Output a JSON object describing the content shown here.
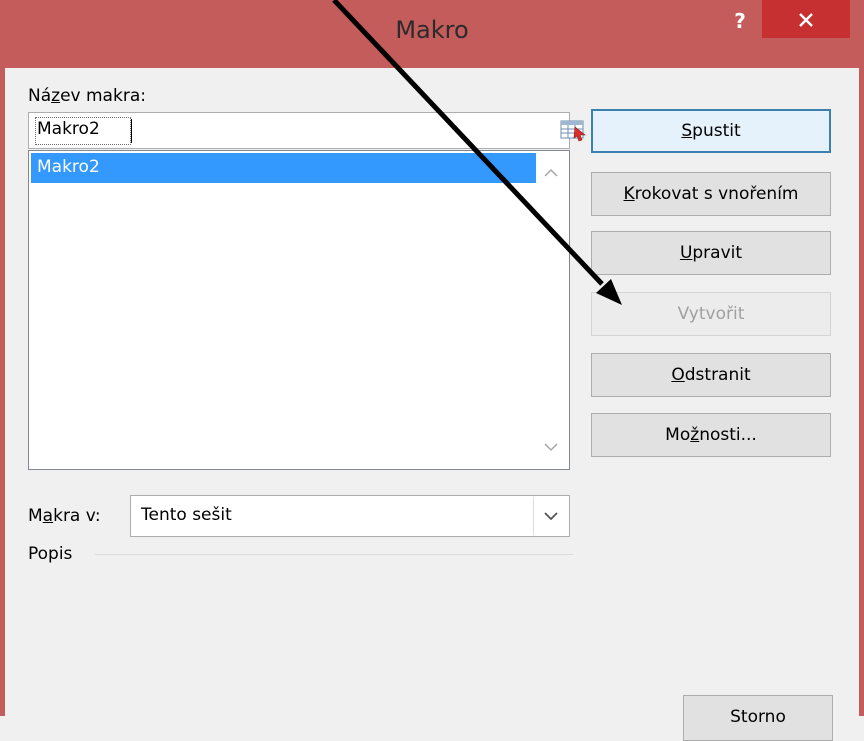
{
  "window": {
    "title": "Makro",
    "help_glyph": "?"
  },
  "macro_name": {
    "label_pre": "Ná",
    "label_key": "z",
    "label_post": "ev makra:",
    "value": "Makro2"
  },
  "macro_list": {
    "items": [
      {
        "label": "Makro2",
        "selected": true
      }
    ]
  },
  "buttons": {
    "run": {
      "key": "S",
      "rest": "pustit"
    },
    "step_into": {
      "key": "K",
      "rest": "rokovat s vnořením"
    },
    "edit": {
      "key": "U",
      "rest": "pravit"
    },
    "create": {
      "label": "Vytvořit",
      "disabled": true
    },
    "delete": {
      "key": "O",
      "rest": "dstranit"
    },
    "options": {
      "pre": "Mo",
      "key": "ž",
      "rest": "nosti..."
    },
    "cancel": {
      "label": "Storno"
    }
  },
  "macros_in": {
    "label_pre": "M",
    "label_key": "a",
    "label_post": "kra v:",
    "value": "Tento sešit"
  },
  "description": {
    "label": "Popis"
  },
  "colors": {
    "titlebar": "#c55c5c",
    "close_button": "#c73030",
    "selection": "#3399ff",
    "annotation_arrow": "#000000"
  }
}
